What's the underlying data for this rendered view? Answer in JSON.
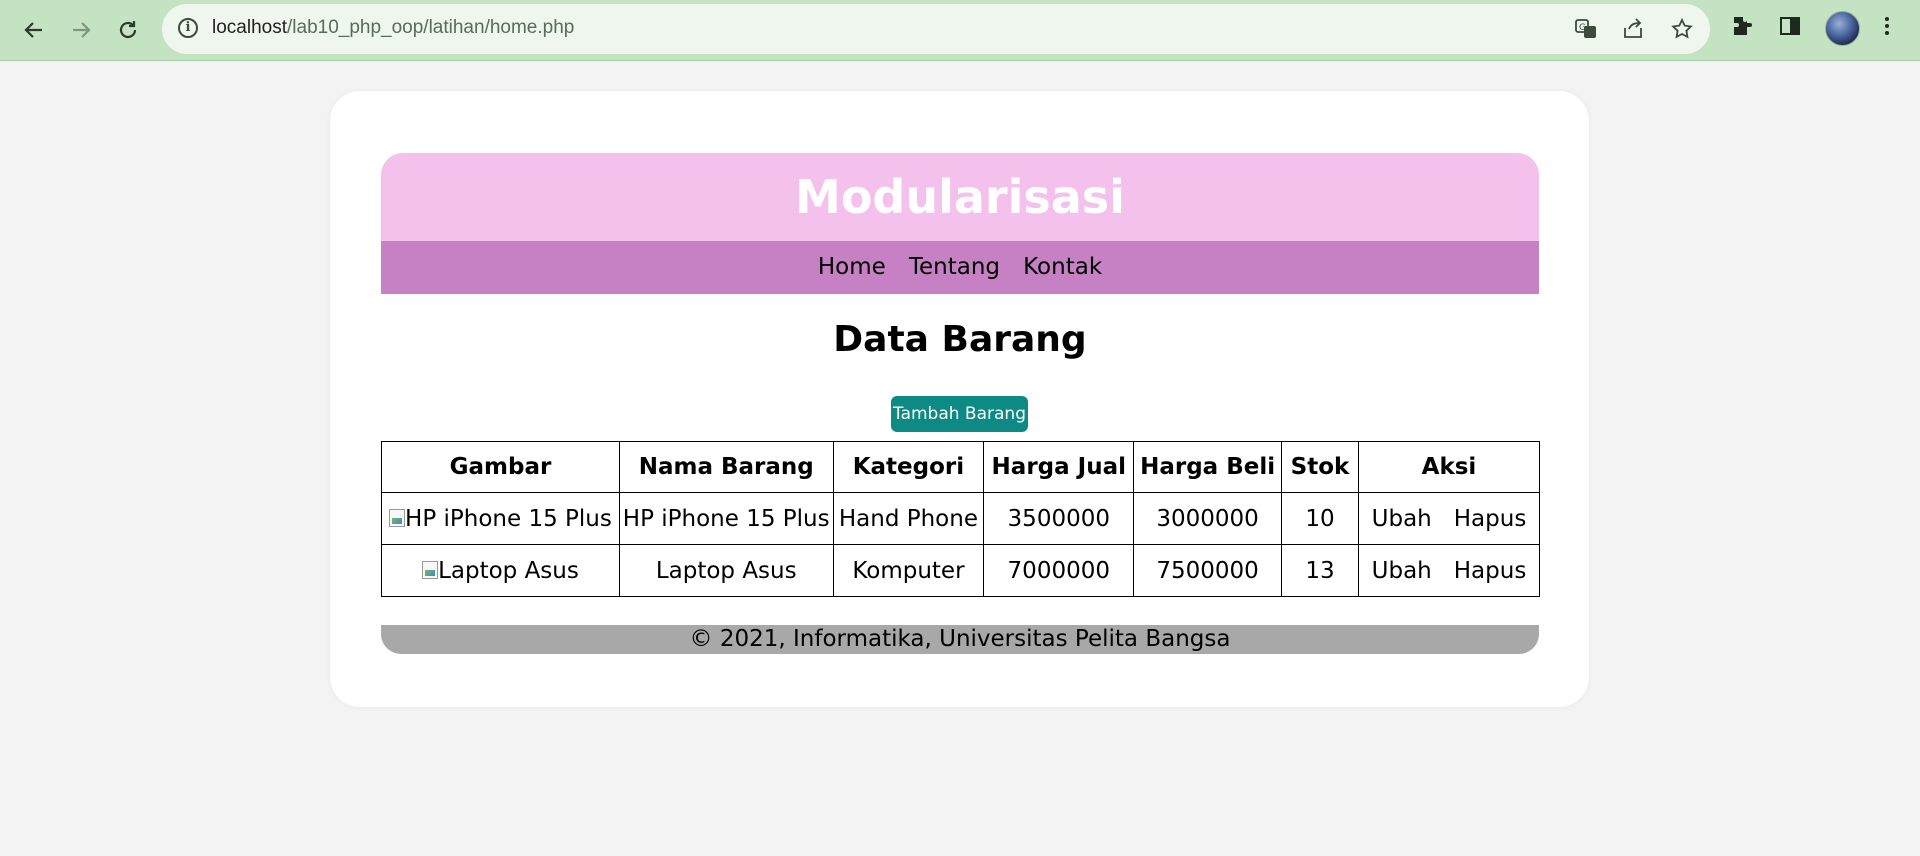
{
  "browser": {
    "url_host": "localhost",
    "url_path": "/lab10_php_oop/latihan/home.php"
  },
  "header": {
    "title": "Modularisasi"
  },
  "nav": {
    "items": [
      "Home",
      "Tentang",
      "Kontak"
    ]
  },
  "main": {
    "title": "Data Barang",
    "add_button": "Tambah Barang"
  },
  "table": {
    "headers": [
      "Gambar",
      "Nama Barang",
      "Kategori",
      "Harga Jual",
      "Harga Beli",
      "Stok",
      "Aksi"
    ],
    "rows": [
      {
        "gambar_alt": "HP iPhone 15 Plus",
        "nama": "HP iPhone 15 Plus",
        "kategori": "Hand Phone",
        "harga_jual": "3500000",
        "harga_beli": "3000000",
        "stok": "10",
        "ubah": "Ubah",
        "hapus": "Hapus"
      },
      {
        "gambar_alt": "Laptop Asus",
        "nama": "Laptop Asus",
        "kategori": "Komputer",
        "harga_jual": "7000000",
        "harga_beli": "7500000",
        "stok": "13",
        "ubah": "Ubah",
        "hapus": "Hapus"
      }
    ]
  },
  "footer": {
    "text": "© 2021, Informatika, Universitas Pelita Bangsa"
  },
  "colors": {
    "header_bg": "#f3c1ec",
    "nav_bg": "#c680c4",
    "button_bg": "#0e8a85",
    "footer_bg": "#a8a8a8"
  }
}
